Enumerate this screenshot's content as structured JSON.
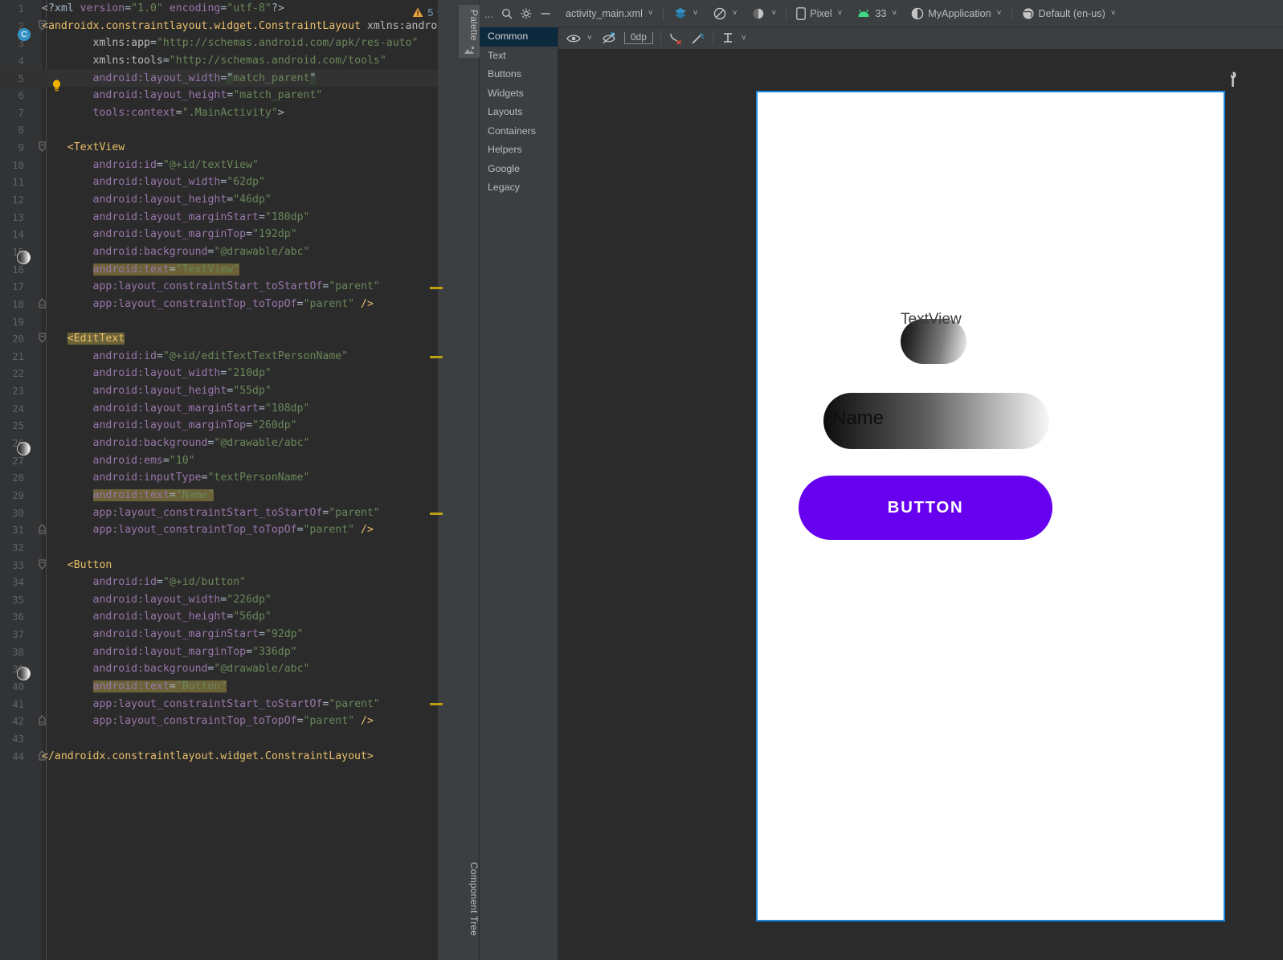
{
  "editor": {
    "inspection": {
      "warning_count": "5",
      "up_icon": "chevron-up-icon",
      "down_icon": "chevron-down-icon"
    },
    "lines": [
      {
        "n": "1",
        "html": "<span class='t-punct'>&lt;?xml </span><span class='t-attr'>version</span><span class='t-punct'>=</span><span class='t-val'>\"1.0\"</span><span class='t-attr'> encoding</span><span class='t-punct'>=</span><span class='t-val'>\"utf-8\"</span><span class='t-punct'>?&gt;</span>"
      },
      {
        "n": "2",
        "html": "<span class='t-tag'>&lt;androidx.constraintlayout.widget.ConstraintLayout </span><span class='t-ns'>xmlns:android</span><span class='t-punct'>=</span>"
      },
      {
        "n": "3",
        "html": "        <span class='t-ns'>xmlns:app</span><span class='t-punct'>=</span><span class='t-val'>\"http://schemas.android.com/apk/res-auto\"</span>"
      },
      {
        "n": "4",
        "html": "        <span class='t-ns'>xmlns:tools</span><span class='t-punct'>=</span><span class='t-val'>\"http://schemas.android.com/tools\"</span>"
      },
      {
        "n": "5",
        "html": "        <span class='t-attr'>android:layout_width</span><span class='t-punct'>=</span><span class='sel t-punct'>\"</span><span class='t-val'>match_parent</span><span class='sel t-punct'>\"</span>",
        "hl": true
      },
      {
        "n": "6",
        "html": "        <span class='t-attr'>android:layout_height</span><span class='t-punct'>=</span><span class='t-val'>\"match_parent\"</span>"
      },
      {
        "n": "7",
        "html": "        <span class='t-attr'>tools:context</span><span class='t-punct'>=</span><span class='t-val'>\".MainActivity\"</span><span class='t-punct'>&gt;</span>"
      },
      {
        "n": "8",
        "html": ""
      },
      {
        "n": "9",
        "html": "    <span class='t-tag'>&lt;TextView</span>"
      },
      {
        "n": "10",
        "html": "        <span class='t-attr'>android:id</span><span class='t-punct'>=</span><span class='t-val'>\"@+id/textView\"</span>"
      },
      {
        "n": "11",
        "html": "        <span class='t-attr'>android:layout_width</span><span class='t-punct'>=</span><span class='t-val'>\"62dp\"</span>"
      },
      {
        "n": "12",
        "html": "        <span class='t-attr'>android:layout_height</span><span class='t-punct'>=</span><span class='t-val'>\"46dp\"</span>"
      },
      {
        "n": "13",
        "html": "        <span class='t-attr'>android:layout_marginStart</span><span class='t-punct'>=</span><span class='t-val'>\"180dp\"</span>"
      },
      {
        "n": "14",
        "html": "        <span class='t-attr'>android:layout_marginTop</span><span class='t-punct'>=</span><span class='t-val'>\"192dp\"</span>"
      },
      {
        "n": "15",
        "html": "        <span class='t-attr'>android:background</span><span class='t-punct'>=</span><span class='t-val'>\"@drawable/abc\"</span>"
      },
      {
        "n": "16",
        "html": "        <span class='idhl'><span class='t-attr'>android:text</span><span class='t-punct'>=</span><span class='t-val'>\"TextView\"</span></span>"
      },
      {
        "n": "17",
        "html": "        <span class='t-attr'>app:layout_constraintStart_toStartOf</span><span class='t-punct'>=</span><span class='t-val'>\"parent\"</span>"
      },
      {
        "n": "18",
        "html": "        <span class='t-attr'>app:layout_constraintTop_toTopOf</span><span class='t-punct'>=</span><span class='t-val'>\"parent\"</span> <span class='t-tag'>/&gt;</span>"
      },
      {
        "n": "19",
        "html": ""
      },
      {
        "n": "20",
        "html": "    <span class='taghl t-tag'>&lt;EditText</span>"
      },
      {
        "n": "21",
        "html": "        <span class='t-attr'>android:id</span><span class='t-punct'>=</span><span class='t-val'>\"@+id/editTextTextPersonName\"</span>"
      },
      {
        "n": "22",
        "html": "        <span class='t-attr'>android:layout_width</span><span class='t-punct'>=</span><span class='t-val'>\"210dp\"</span>"
      },
      {
        "n": "23",
        "html": "        <span class='t-attr'>android:layout_height</span><span class='t-punct'>=</span><span class='t-val'>\"55dp\"</span>"
      },
      {
        "n": "24",
        "html": "        <span class='t-attr'>android:layout_marginStart</span><span class='t-punct'>=</span><span class='t-val'>\"108dp\"</span>"
      },
      {
        "n": "25",
        "html": "        <span class='t-attr'>android:layout_marginTop</span><span class='t-punct'>=</span><span class='t-val'>\"260dp\"</span>"
      },
      {
        "n": "26",
        "html": "        <span class='t-attr'>android:background</span><span class='t-punct'>=</span><span class='t-val'>\"@drawable/abc\"</span>"
      },
      {
        "n": "27",
        "html": "        <span class='t-attr'>android:ems</span><span class='t-punct'>=</span><span class='t-val'>\"10\"</span>"
      },
      {
        "n": "28",
        "html": "        <span class='t-attr'>android:inputType</span><span class='t-punct'>=</span><span class='t-val'>\"textPersonName\"</span>"
      },
      {
        "n": "29",
        "html": "        <span class='idhl'><span class='t-attr'>android:text</span><span class='t-punct'>=</span><span class='t-val'>\"Name\"</span></span>"
      },
      {
        "n": "30",
        "html": "        <span class='t-attr'>app:layout_constraintStart_toStartOf</span><span class='t-punct'>=</span><span class='t-val'>\"parent\"</span>"
      },
      {
        "n": "31",
        "html": "        <span class='t-attr'>app:layout_constraintTop_toTopOf</span><span class='t-punct'>=</span><span class='t-val'>\"parent\"</span> <span class='t-tag'>/&gt;</span>"
      },
      {
        "n": "32",
        "html": ""
      },
      {
        "n": "33",
        "html": "    <span class='t-tag'>&lt;Button</span>"
      },
      {
        "n": "34",
        "html": "        <span class='t-attr'>android:id</span><span class='t-punct'>=</span><span class='t-val'>\"@+id/button\"</span>"
      },
      {
        "n": "35",
        "html": "        <span class='t-attr'>android:layout_width</span><span class='t-punct'>=</span><span class='t-val'>\"226dp\"</span>"
      },
      {
        "n": "36",
        "html": "        <span class='t-attr'>android:layout_height</span><span class='t-punct'>=</span><span class='t-val'>\"56dp\"</span>"
      },
      {
        "n": "37",
        "html": "        <span class='t-attr'>android:layout_marginStart</span><span class='t-punct'>=</span><span class='t-val'>\"92dp\"</span>"
      },
      {
        "n": "38",
        "html": "        <span class='t-attr'>android:layout_marginTop</span><span class='t-punct'>=</span><span class='t-val'>\"336dp\"</span>"
      },
      {
        "n": "39",
        "html": "        <span class='t-attr'>android:background</span><span class='t-punct'>=</span><span class='t-val'>\"@drawable/abc\"</span>"
      },
      {
        "n": "40",
        "html": "        <span class='idhl'><span class='t-attr'>android:text</span><span class='t-punct'>=</span><span class='t-val'>\"Button\"</span></span>"
      },
      {
        "n": "41",
        "html": "        <span class='t-attr'>app:layout_constraintStart_toStartOf</span><span class='t-punct'>=</span><span class='t-val'>\"parent\"</span>"
      },
      {
        "n": "42",
        "html": "        <span class='t-attr'>app:layout_constraintTop_toTopOf</span><span class='t-punct'>=</span><span class='t-val'>\"parent\"</span> <span class='t-tag'>/&gt;</span>"
      },
      {
        "n": "43",
        "html": ""
      },
      {
        "n": "44",
        "html": "<span class='t-tag'>&lt;/androidx.constraintlayout.widget.ConstraintLayout&gt;</span>"
      }
    ],
    "gutter": {
      "class_badge_line": 2,
      "class_badge_letter": "C",
      "bulb_line": 5,
      "color_swatch_lines": [
        15,
        26,
        39
      ]
    }
  },
  "tool_strip": {
    "palette_tab": "Palette",
    "component_tree_tab": "Component Tree",
    "resource_icon": "resource-manager-icon"
  },
  "palette": {
    "header": {
      "more_label": "...",
      "search_icon": "search-icon",
      "gear_icon": "gear-icon",
      "minimize_icon": "minimize-icon"
    },
    "items": [
      {
        "label": "Common",
        "selected": true
      },
      {
        "label": "Text",
        "selected": false
      },
      {
        "label": "Buttons",
        "selected": false
      },
      {
        "label": "Widgets",
        "selected": false
      },
      {
        "label": "Layouts",
        "selected": false
      },
      {
        "label": "Containers",
        "selected": false
      },
      {
        "label": "Helpers",
        "selected": false
      },
      {
        "label": "Google",
        "selected": false
      },
      {
        "label": "Legacy",
        "selected": false
      }
    ]
  },
  "design_toolbar": {
    "file_name": "activity_main.xml",
    "view_mode_icon": "design-surface-mode-icon",
    "orientation_icon": "orientation-icon",
    "theme_icon": "night-mode-icon",
    "device_icon": "phone-icon",
    "device_name": "Pixel",
    "api_icon": "android-icon",
    "api_level": "33",
    "theme_label_icon": "theme-icon",
    "theme_name": "MyApplication",
    "locale_icon": "globe-icon",
    "locale_name": "Default (en-us)"
  },
  "design_toolbar2": {
    "visibility_icon": "eye-icon",
    "constraints_icon": "hide-constraints-icon",
    "margin_value": "0dp",
    "clear_constraints_icon": "clear-constraints-icon",
    "infer_constraints_icon": "magic-wand-icon",
    "guideline_icon": "guideline-icon",
    "wrench_icon": "wrench-icon"
  },
  "preview": {
    "textview": {
      "text": "TextView",
      "background": "gradient-drawable"
    },
    "edittext": {
      "text": "Name",
      "background": "gradient-drawable"
    },
    "button": {
      "text": "BUTTON",
      "color": "#6600ee"
    },
    "selection_border_color": "#1a88e0",
    "surface_color": "#ffffff"
  }
}
